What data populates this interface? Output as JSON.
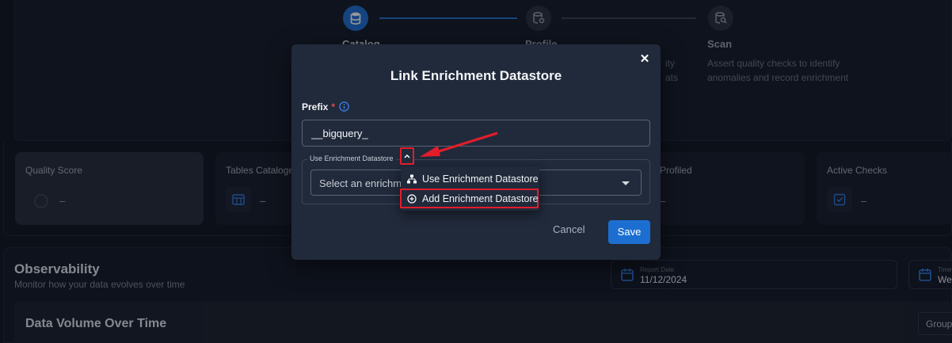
{
  "stepper": {
    "steps": [
      {
        "label": "Catalog",
        "state": "active"
      },
      {
        "label": "Profile",
        "state": "idle",
        "desc_line1": "ity",
        "desc_line2": "ats"
      },
      {
        "label": "Scan",
        "state": "idle",
        "desc_line1": "Assert quality checks to identify",
        "desc_line2": "anomalies and record enrichment"
      }
    ]
  },
  "stats": {
    "quality_score": {
      "title": "Quality Score",
      "value": "–"
    },
    "tables_cataloged": {
      "title": "Tables Cataloged",
      "value": "–"
    },
    "profiled": {
      "title": "Profiled",
      "value": "–"
    },
    "active_checks": {
      "title": "Active Checks",
      "value": "–"
    }
  },
  "observability": {
    "title": "Observability",
    "subtitle": "Monitor how your data evolves over time",
    "report_date_label": "Report Date",
    "report_date_value": "11/12/2024",
    "timeframe_label": "Timeframe",
    "timeframe_value": "Weekly"
  },
  "data_volume": {
    "title": "Data Volume Over Time",
    "group_label": "Group"
  },
  "modal": {
    "title": "Link Enrichment Datastore",
    "close_glyph": "✕",
    "prefix_label": "Prefix",
    "required_mark": "*",
    "prefix_value": "__bigquery_",
    "fieldset_legend": "Use Enrichment Datastore",
    "select_placeholder": "Select an enrichment datastore",
    "dropdown_options": [
      "Use Enrichment Datastore",
      "Add Enrichment Datastore"
    ],
    "cancel_label": "Cancel",
    "save_label": "Save"
  },
  "colors": {
    "accent": "#1c6fd0",
    "highlight": "#e11d2a",
    "modal_bg": "#212a3b"
  }
}
